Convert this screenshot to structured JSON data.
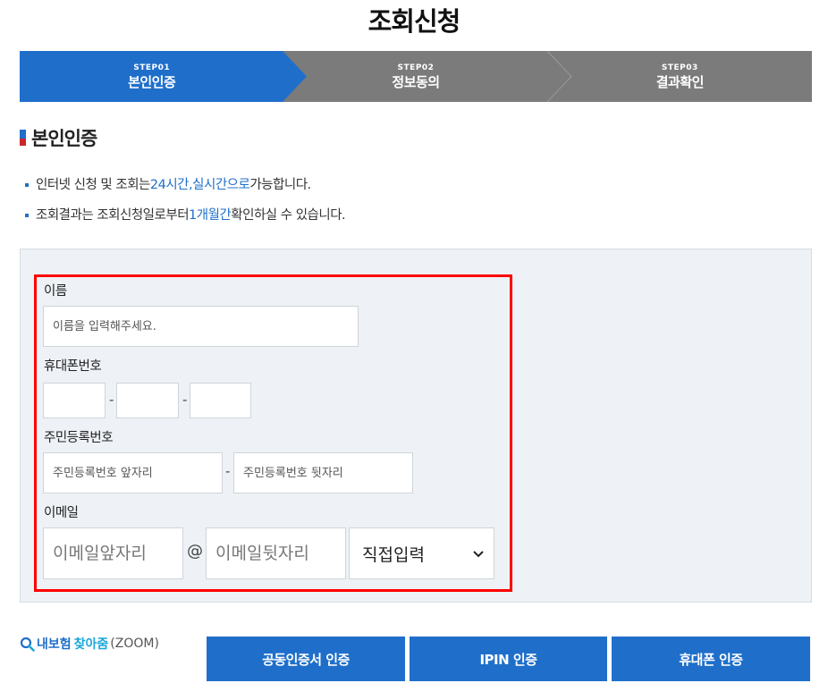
{
  "page_title": "조회신청",
  "steps": [
    {
      "num": "STEP01",
      "label": "본인인증",
      "active": true
    },
    {
      "num": "STEP02",
      "label": "정보동의",
      "active": false
    },
    {
      "num": "STEP03",
      "label": "결과확인",
      "active": false
    }
  ],
  "section_title": "본인인증",
  "notes": {
    "n1": {
      "a": "인터넷 신청 및 조회는 ",
      "hl1": "24시간",
      "b": ", ",
      "hl2": "실시간으로",
      "c": " 가능합니다."
    },
    "n2": {
      "a": "조회결과는 조회신청일로부터 ",
      "hl1": "1개월간",
      "c": " 확인하실 수 있습니다."
    }
  },
  "form": {
    "name": {
      "label": "이름",
      "placeholder": "이름을 입력해주세요."
    },
    "phone": {
      "label": "휴대폰번호",
      "sep": "-"
    },
    "rrn": {
      "label": "주민등록번호",
      "front_placeholder": "주민등록번호 앞자리",
      "back_placeholder": "주민등록번호 뒷자리",
      "sep": "-"
    },
    "email": {
      "label": "이메일",
      "local_placeholder": "이메일앞자리",
      "at": "@",
      "domain_placeholder": "이메일뒷자리",
      "domain_select": "직접입력"
    }
  },
  "zoom": {
    "part1": "내보험",
    "part2": "찾아줌",
    "part3": "(ZOOM)",
    "icon": "search-icon"
  },
  "buttons": {
    "cert": "공동인증서 인증",
    "ipin": "IPIN 인증",
    "phone": "휴대폰 인증"
  },
  "colors": {
    "accent": "#1f6fca",
    "inactive_step": "#7b7b7b",
    "highlight_frame": "#ff0000"
  }
}
